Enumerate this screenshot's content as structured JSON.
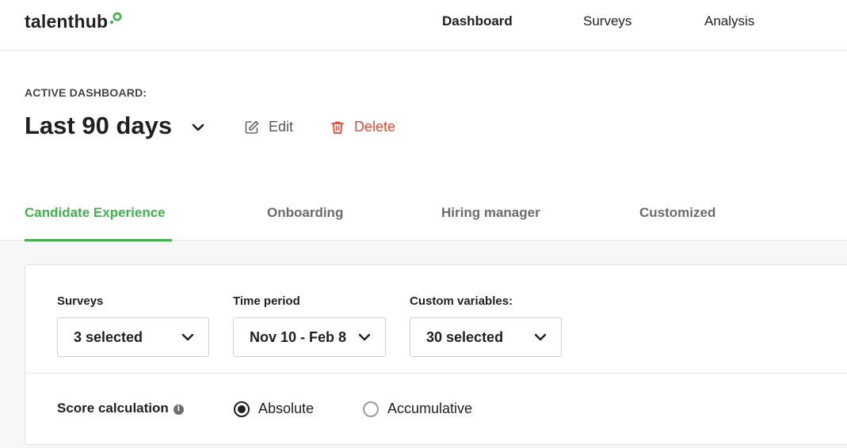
{
  "brand": {
    "name": "talenthub",
    "accent_color": "#3cb54a",
    "logo_icon": "logo-ring-icon"
  },
  "nav": {
    "items": [
      {
        "label": "Dashboard",
        "active": true
      },
      {
        "label": "Surveys",
        "active": false
      },
      {
        "label": "Analysis",
        "active": false
      }
    ]
  },
  "dashboard": {
    "active_label": "ACTIVE DASHBOARD:",
    "title": "Last 90 days",
    "title_icon": "chevron-down-icon",
    "edit": {
      "label": "Edit",
      "icon": "pencil-square-icon"
    },
    "delete": {
      "label": "Delete",
      "icon": "trash-icon",
      "color": "#e8472f"
    }
  },
  "tabs": [
    {
      "label": "Candidate Experience",
      "active": true
    },
    {
      "label": "Onboarding",
      "active": false
    },
    {
      "label": "Hiring manager",
      "active": false
    },
    {
      "label": "Customized",
      "active": false
    }
  ],
  "filters": [
    {
      "label": "Surveys",
      "value": "3 selected"
    },
    {
      "label": "Time period",
      "value": "Nov 10 - Feb 8"
    },
    {
      "label": "Custom variables:",
      "value": "30 selected"
    }
  ],
  "score": {
    "label": "Score calculation",
    "info_icon": "info-icon",
    "options": [
      {
        "label": "Absolute",
        "selected": true
      },
      {
        "label": "Accumulative",
        "selected": false
      }
    ]
  }
}
